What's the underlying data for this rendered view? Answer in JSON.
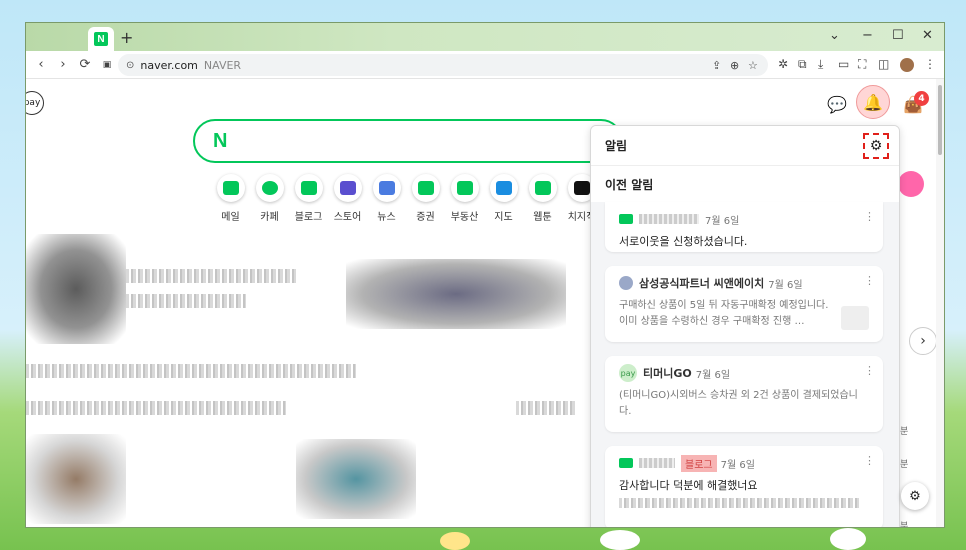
{
  "browser": {
    "url": "naver.com",
    "page_title": "NAVER",
    "tab_favicon": "N",
    "new_tab": "+"
  },
  "header": {
    "pay_label": "pay",
    "cart_count": "4"
  },
  "search": {
    "logo": "N"
  },
  "shortcuts": [
    {
      "label": "메일"
    },
    {
      "label": "카페"
    },
    {
      "label": "블로그"
    },
    {
      "label": "스토어"
    },
    {
      "label": "뉴스"
    },
    {
      "label": "증권"
    },
    {
      "label": "부동산"
    },
    {
      "label": "지도"
    },
    {
      "label": "웹툰"
    },
    {
      "label": "치지직"
    }
  ],
  "notifications": {
    "title": "알림",
    "section": "이전 알림",
    "items": [
      {
        "sender": "",
        "date": "7월 6일",
        "body": "서로이웃을 신청하셨습니다."
      },
      {
        "sender": "삼성공식파트너 씨앤에이치",
        "date": "7월 6일",
        "body": "구매하신 상품이 5일 뒤 자동구매확정 예정입니다. 이미 상품을 수령하신 경우 구매확정 진행 …"
      },
      {
        "sender": "티머니GO",
        "date": "7월 6일",
        "icon_text": "pay",
        "body": "(티머니GO)시외버스 승차권 외 2건 상품이 결제되었습니다."
      },
      {
        "sender": "",
        "tag": "블로그",
        "date": "7월 6일",
        "body": "감사합니다 덕분에 해결했너요"
      }
    ]
  },
  "side": {
    "text1": "분",
    "text2": "분",
    "text3": "분"
  },
  "colors": {
    "naver_green": "#03c75a",
    "highlight_red": "#e0201a"
  }
}
